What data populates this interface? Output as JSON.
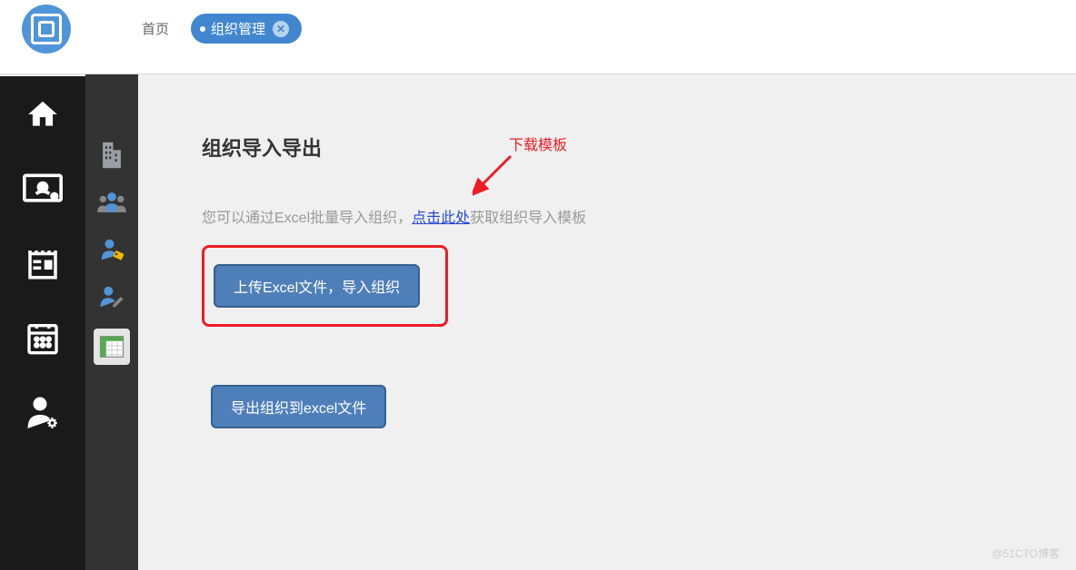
{
  "header": {
    "breadcrumb_home": "首页",
    "breadcrumb_active": "组织管理"
  },
  "primary_nav": {
    "home": "home-icon",
    "monitor": "monitor-icon",
    "news": "news-icon",
    "calendar": "calendar-icon",
    "user_settings": "user-settings-icon"
  },
  "secondary_nav": {
    "building": "building-icon",
    "users": "users-icon",
    "person_tag": "person-tag-icon",
    "user_edit": "user-edit-icon",
    "spreadsheet": "spreadsheet-icon"
  },
  "main": {
    "title": "组织导入导出",
    "hint_before": "您可以通过Excel批量导入组织，",
    "hint_link": "点击此处",
    "hint_after": "获取组织导入模板",
    "upload_btn": "上传Excel文件，导入组织",
    "export_btn": "导出组织到excel文件"
  },
  "annotation": {
    "text": "下载模板"
  },
  "watermark": "@51CTO博客"
}
